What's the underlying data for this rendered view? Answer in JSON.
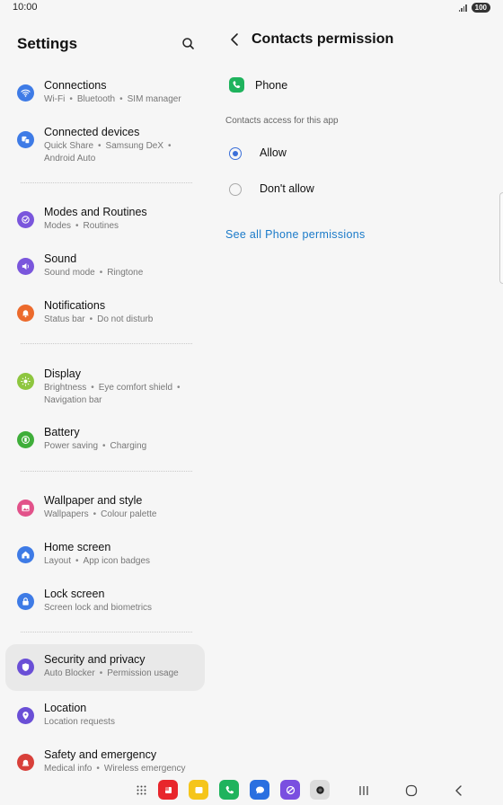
{
  "status_bar": {
    "time": "10:00",
    "battery": "100"
  },
  "settings": {
    "title": "Settings",
    "items": [
      {
        "title": "Connections",
        "sub": [
          "Wi-Fi",
          "Bluetooth",
          "SIM manager"
        ],
        "icon": "wifi-icon",
        "color": "#3e7be6"
      },
      {
        "title": "Connected devices",
        "sub": [
          "Quick Share",
          "Samsung DeX",
          "Android Auto"
        ],
        "icon": "devices-icon",
        "color": "#3e7be6"
      },
      {
        "title": "Modes and Routines",
        "sub": [
          "Modes",
          "Routines"
        ],
        "icon": "modes-icon",
        "color": "#7a56dc"
      },
      {
        "title": "Sound",
        "sub": [
          "Sound mode",
          "Ringtone"
        ],
        "icon": "speaker-icon",
        "color": "#7a56dc"
      },
      {
        "title": "Notifications",
        "sub": [
          "Status bar",
          "Do not disturb"
        ],
        "icon": "bell-icon",
        "color": "#ec6a2c"
      },
      {
        "title": "Display",
        "sub": [
          "Brightness",
          "Eye comfort shield",
          "Navigation bar"
        ],
        "icon": "sun-icon",
        "color": "#8ec63f"
      },
      {
        "title": "Battery",
        "sub": [
          "Power saving",
          "Charging"
        ],
        "icon": "battery-icon",
        "color": "#3fae3a"
      },
      {
        "title": "Wallpaper and style",
        "sub": [
          "Wallpapers",
          "Colour palette"
        ],
        "icon": "image-icon",
        "color": "#e2528a"
      },
      {
        "title": "Home screen",
        "sub": [
          "Layout",
          "App icon badges"
        ],
        "icon": "home-icon",
        "color": "#3e7be6"
      },
      {
        "title": "Lock screen",
        "sub": [
          "Screen lock and biometrics"
        ],
        "icon": "lock-icon",
        "color": "#3e7be6"
      },
      {
        "title": "Security and privacy",
        "sub": [
          "Auto Blocker",
          "Permission usage"
        ],
        "icon": "shield-icon",
        "color": "#6a4fd6"
      },
      {
        "title": "Location",
        "sub": [
          "Location requests"
        ],
        "icon": "location-pin-icon",
        "color": "#6a4fd6"
      },
      {
        "title": "Safety and emergency",
        "sub": [
          "Medical info",
          "Wireless emergency"
        ],
        "icon": "emergency-icon",
        "color": "#d8403a"
      }
    ]
  },
  "detail": {
    "title": "Contacts permission",
    "app_name": "Phone",
    "section_label": "Contacts access for this app",
    "options": [
      {
        "label": "Allow",
        "checked": true
      },
      {
        "label": "Don't allow",
        "checked": false
      }
    ],
    "link": "See all Phone permissions"
  },
  "dock": [
    {
      "icon": "app-grid-icon"
    },
    {
      "icon": "flipboard-icon",
      "color": "#e8262c"
    },
    {
      "icon": "notes-icon",
      "color": "#f5c51a"
    },
    {
      "icon": "phone-app-icon",
      "color": "#1fb35d"
    },
    {
      "icon": "messages-icon",
      "color": "#2a6fe0"
    },
    {
      "icon": "internet-icon",
      "color": "#7a4fe0"
    },
    {
      "icon": "camera-icon",
      "color": "#dcdcdc"
    }
  ]
}
